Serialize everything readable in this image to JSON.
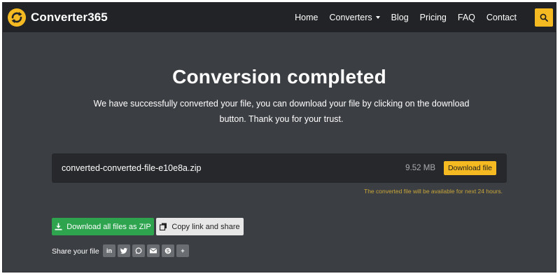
{
  "app": {
    "name": "Converter365",
    "accent_color": "#f5b921",
    "background_color": "#3b3e42",
    "navbar_color": "#222326"
  },
  "nav": {
    "items": [
      "Home",
      "Converters",
      "Blog",
      "Pricing",
      "FAQ",
      "Contact"
    ],
    "search_icon": "search-icon"
  },
  "hero": {
    "title": "Conversion completed",
    "description": "We have successfully converted your file, you can download your file by clicking on the download button. Thank you for your trust."
  },
  "file": {
    "name": "converted-converted-file-e10e8a.zip",
    "size": "9.52 MB",
    "download_label": "Download file",
    "availability_note": "The converted file will be available for next 24 hours."
  },
  "actions": {
    "zip_label": "Download all files as ZIP",
    "zip_icon": "download-icon",
    "zip_color": "#2ea44f",
    "copy_label": "Copy link and share",
    "copy_icon": "copy-icon"
  },
  "share": {
    "label": "Share your file",
    "icons": [
      {
        "name": "linkedin-icon",
        "glyph": "in"
      },
      {
        "name": "twitter-icon",
        "glyph": ""
      },
      {
        "name": "whatsapp-icon",
        "glyph": ""
      },
      {
        "name": "email-icon",
        "glyph": ""
      },
      {
        "name": "skype-icon",
        "glyph": ""
      },
      {
        "name": "more-icon",
        "glyph": "+"
      }
    ]
  }
}
